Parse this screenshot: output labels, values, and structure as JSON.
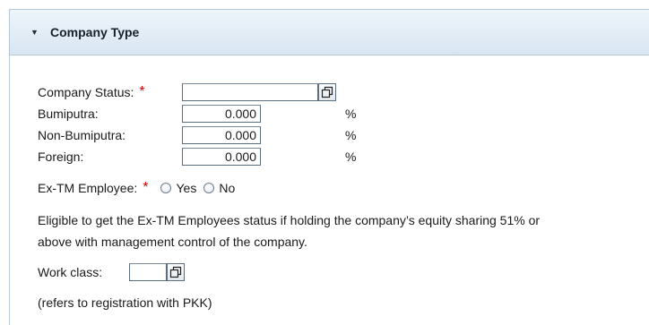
{
  "section": {
    "title": "Company Type"
  },
  "fields": {
    "company_status": {
      "label": "Company Status:",
      "required_mark": "*",
      "value": ""
    },
    "bumiputra": {
      "label": "Bumiputra:",
      "value": "0.000",
      "unit": "%"
    },
    "non_bumiputra": {
      "label": "Non-Bumiputra:",
      "value": "0.000",
      "unit": "%"
    },
    "foreign": {
      "label": "Foreign:",
      "value": "0.000",
      "unit": "%"
    },
    "ex_tm_employee": {
      "label": "Ex-TM Employee:",
      "required_mark": "*",
      "options": [
        "Yes",
        "No"
      ],
      "selected": null
    },
    "work_class": {
      "label": "Work class:",
      "value": ""
    }
  },
  "notes": {
    "eligibility_line1": "Eligible to get the Ex-TM Employees status if holding the company’s equity sharing 51% or",
    "eligibility_line2": "above with management control of the company.",
    "work_class_note": "(refers to registration with PKK)"
  },
  "icons": {
    "toggle": "triangle-down-icon",
    "value_help": "value-help-icon"
  },
  "colors": {
    "header_bg": "#dbe7f2",
    "border": "#b7c8d9",
    "required": "#d40000"
  }
}
